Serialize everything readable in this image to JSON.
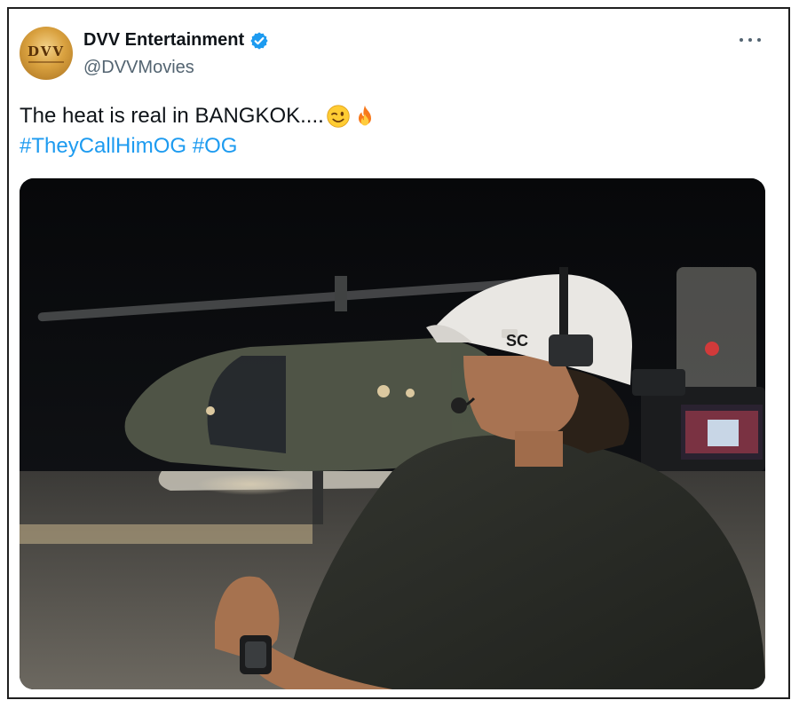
{
  "tweet": {
    "author": {
      "display_name": "DVV Entertainment",
      "handle": "@DVVMovies",
      "verified": true,
      "avatar_text": "DVV",
      "avatar_icon": "dvv-logo-avatar"
    },
    "text_main": "The heat is real in BANGKOK....",
    "emojis": [
      "winking-face",
      "fire"
    ],
    "hashtags": [
      "#TheyCallHimOG",
      "#OG"
    ],
    "more_icon": "more-horizontal-icon",
    "media": {
      "type": "photo",
      "icon": "tweet-photo"
    }
  },
  "colors": {
    "text": "#0f1419",
    "secondary": "#536471",
    "link": "#1d9bf0",
    "verified": "#1d9bf0",
    "border": "#1f1f1f"
  }
}
